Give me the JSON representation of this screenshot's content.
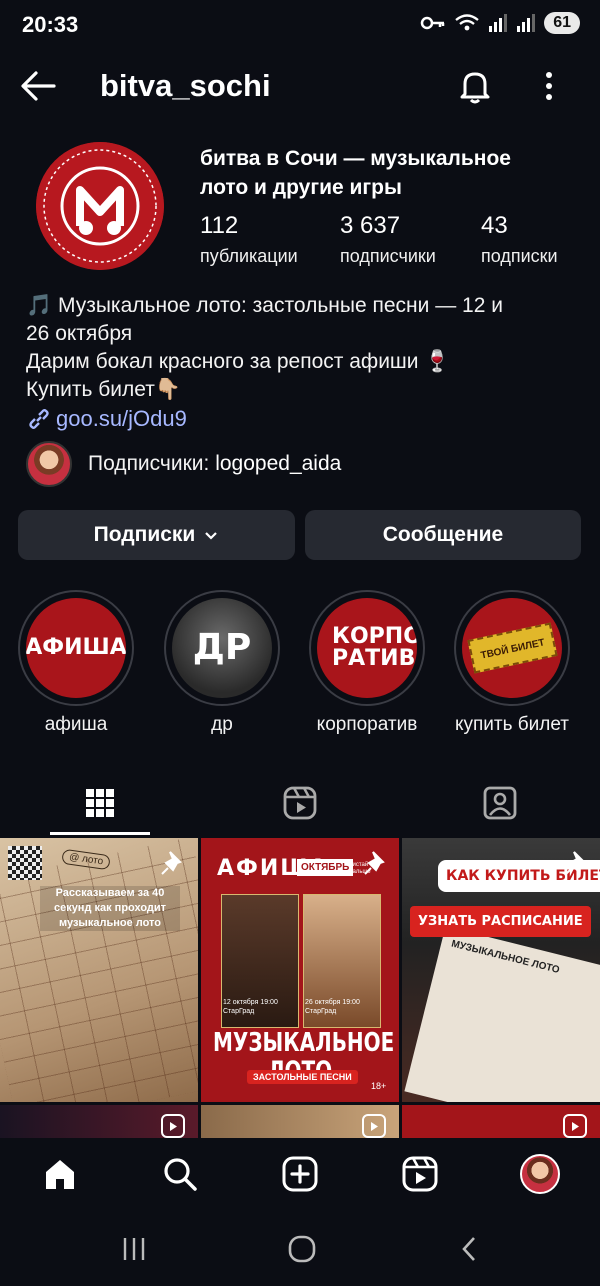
{
  "status_bar": {
    "time": "20:33",
    "battery": "61"
  },
  "header": {
    "username": "bitva_sochi"
  },
  "profile": {
    "display_name": "битва в Сочи — музыкальное лото и другие игры",
    "avatar_logo_text": "МУЗЫКАЛЬНОЕ ЛОТО • MUSICAL LOTTO",
    "stats": [
      {
        "value": "112",
        "label": "публикации"
      },
      {
        "value": "3 637",
        "label": "подписчики"
      },
      {
        "value": "43",
        "label": "подписки"
      }
    ],
    "bio_lines": [
      "🎵 Музыкальное лото: застольные песни — 12 и",
      "26 октября",
      "Дарим бокал красного за репост афиши 🍷",
      "Купить билет👇🏼"
    ],
    "link": "goo.su/jOdu9",
    "followed_by_prefix": "Подписчики: ",
    "followed_by_user": "logoped_aida"
  },
  "actions": {
    "following_label": "Подписки",
    "message_label": "Сообщение"
  },
  "highlights": [
    {
      "label": "афиша",
      "cover_text": "АФИША"
    },
    {
      "label": "др",
      "cover_text": "ДР"
    },
    {
      "label": "корпоратив",
      "cover_text": "КОРПО РАТИВ"
    },
    {
      "label": "купить билет",
      "cover_text": "ТВОЙ БИЛЕТ"
    }
  ],
  "tabs": [
    "grid-icon",
    "reels-icon",
    "tagged-icon"
  ],
  "posts": [
    {
      "text": "Рассказываем за 40 секунд как проходит музыкальное лото",
      "highlight": "за 40 секунд",
      "badge": "@ лото"
    },
    {
      "header_left": "АФИША",
      "header_badge": "ОКТЯБРЬ",
      "header_small": "листай дальше",
      "date1": "12 октября 19:00 СтарГрад",
      "date2": "26 октября 19:00 СтарГрад",
      "title": "МУЗЫКАЛЬНОЕ ЛОТО",
      "subtitle": "ЗАСТОЛЬНЫЕ ПЕСНИ",
      "age": "18+"
    },
    {
      "top_banner": "КАК КУПИТЬ БИЛЕТ",
      "red_banner": "УЗНАТЬ РАСПИСАНИЕ",
      "sheet_title": "МУЗЫКАЛЬНОЕ ЛОТО"
    }
  ],
  "colors": {
    "background": "#0b0d14",
    "brand_red": "#b7181f",
    "link": "#a7b8ff",
    "button": "#262931"
  }
}
